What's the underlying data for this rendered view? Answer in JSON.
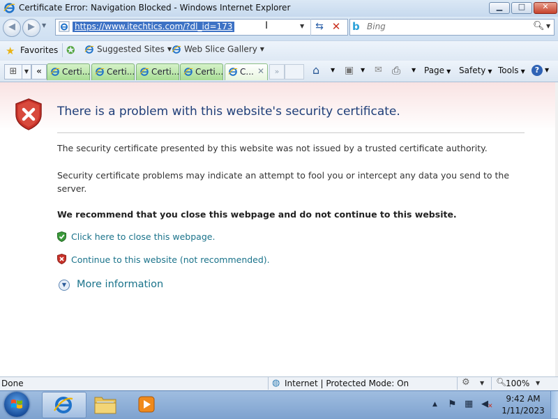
{
  "window": {
    "title": "Certificate Error: Navigation Blocked - Windows Internet Explorer",
    "min_glyph": "▁",
    "max_glyph": "□",
    "close_glyph": "✕"
  },
  "address": {
    "url": "https://www.itechtics.com/?dl_id=173",
    "search_placeholder": "Bing"
  },
  "favorites": {
    "label": "Favorites",
    "links": [
      {
        "label": "Suggested Sites"
      },
      {
        "label": "Web Slice Gallery"
      }
    ]
  },
  "tabs": [
    {
      "label": "Certi..."
    },
    {
      "label": "Certi..."
    },
    {
      "label": "Certi..."
    },
    {
      "label": "Certi..."
    },
    {
      "label": "C...",
      "active": true
    }
  ],
  "commands": {
    "page": "Page",
    "safety": "Safety",
    "tools": "Tools",
    "help": "?"
  },
  "error": {
    "title": "There is a problem with this website's security certificate.",
    "description": "The security certificate presented by this website was not issued by a trusted certificate authority.",
    "problems": "Security certificate problems may indicate an attempt to fool you or intercept any data you send to the server.",
    "recommend": "We recommend that you close this webpage and do not continue to this website.",
    "close_link": "Click here to close this webpage.",
    "continue_link": "Continue to this website (not recommended).",
    "more_info": "More information"
  },
  "status": {
    "text": "Done",
    "zone": "Internet | Protected Mode: On",
    "zoom": "100%"
  },
  "taskbar": {
    "time": "9:42 AM",
    "date": "1/11/2023"
  },
  "colors": {
    "link": "#19728a",
    "title_blue": "#1e3e78",
    "tab_green": "#a7dd94",
    "error_red": "#c8301f"
  },
  "icons": [
    "ie-icon",
    "back-arrow-icon",
    "forward-arrow-icon",
    "refresh-icon",
    "stop-icon",
    "bing-icon",
    "search-icon",
    "favorites-star-icon",
    "add-favorites-icon",
    "home-icon",
    "feeds-icon",
    "mail-icon",
    "print-icon",
    "help-icon",
    "shield-error-icon",
    "shield-check-icon",
    "expand-icon",
    "globe-icon",
    "zoom-icon",
    "windows-start-icon",
    "folder-icon",
    "media-player-icon",
    "action-center-flag-icon",
    "network-icon",
    "volume-muted-icon"
  ]
}
